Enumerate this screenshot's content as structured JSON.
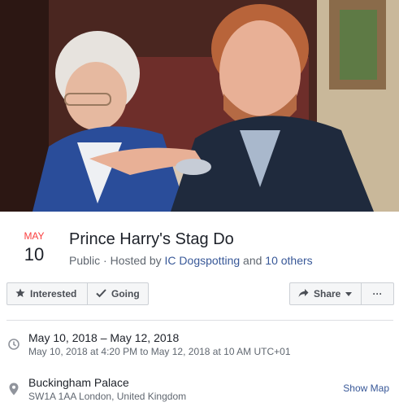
{
  "cover": {
    "alt_icon": "cover-photo"
  },
  "event": {
    "month": "MAY",
    "day": "10",
    "title": "Prince Harry's Stag Do",
    "privacy": "Public",
    "separator": " · ",
    "hosted_by_prefix": "Hosted by ",
    "host": "IC Dogspotting",
    "and": " and ",
    "others": "10 others"
  },
  "actions": {
    "interested_label": "Interested",
    "going_label": "Going",
    "share_label": "Share",
    "more_label": "···"
  },
  "details": {
    "date_range": "May 10, 2018 – May 12, 2018",
    "date_detail": "May 10, 2018 at 4:20 PM to May 12, 2018 at 10 AM UTC+01",
    "location_name": "Buckingham Palace",
    "location_address": "SW1A 1AA London, United Kingdom",
    "show_map_label": "Show Map"
  },
  "colors": {
    "accent": "#385898",
    "month": "#fa3e3e",
    "muted": "#606770"
  }
}
